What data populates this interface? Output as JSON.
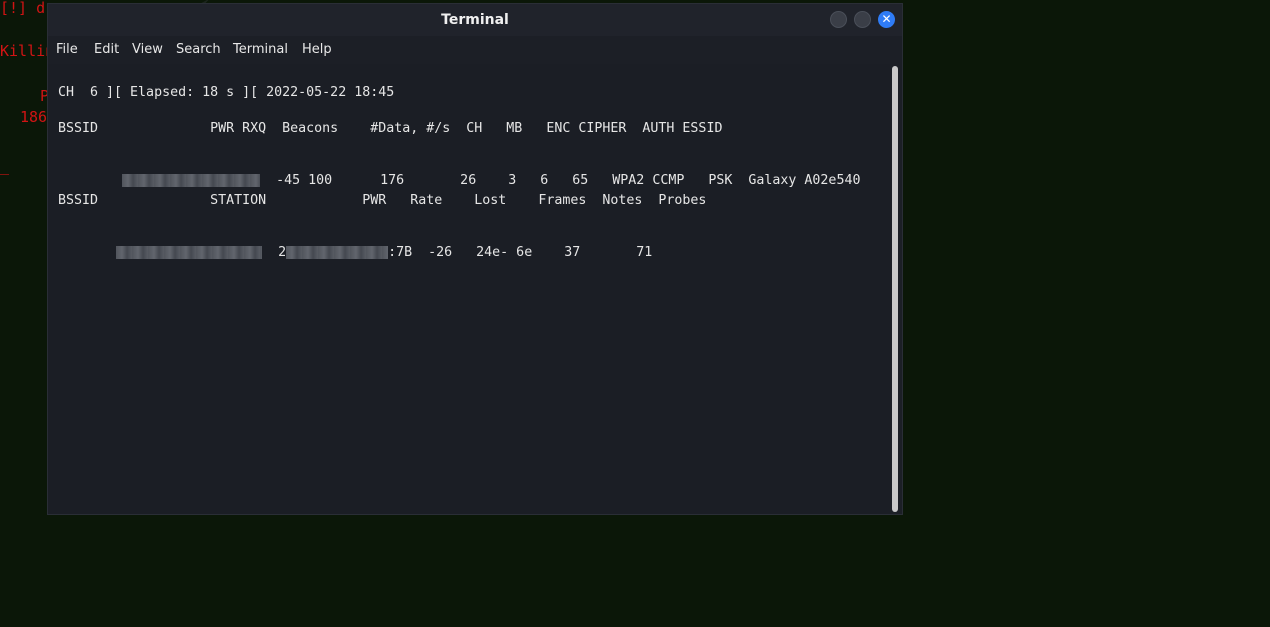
{
  "background": {
    "lines": [
      "[!] d",
      "Killing these processes:",
      "  P",
      "186",
      "_"
    ]
  },
  "window": {
    "title": "Terminal",
    "menu": [
      "File",
      "Edit",
      "View",
      "Search",
      "Terminal",
      "Help"
    ],
    "close_glyph": "✕"
  },
  "airodump": {
    "status": "CH  6 ][ Elapsed: 18 s ][ 2022-05-22 18:45",
    "ap_header": "BSSID              PWR RXQ  Beacons    #Data, #/s  CH   MB   ENC CIPHER  AUTH ESSID",
    "ap_row_rest": "-45 100      176       26    3   6   65   WPA2 CCMP   PSK  Galaxy A02e540",
    "station_header": "BSSID              STATION            PWR   Rate    Lost    Frames  Notes  Probes",
    "station_row_station_prefix": "2",
    "station_row_station_suffix": ":7B",
    "station_row_rest": "-26   24e- 6e    37       71"
  },
  "colors": {
    "desktop": "#0b1708",
    "bg_text": "#d01414",
    "window": "#1c1f26",
    "close_button": "#2f7cf6"
  }
}
